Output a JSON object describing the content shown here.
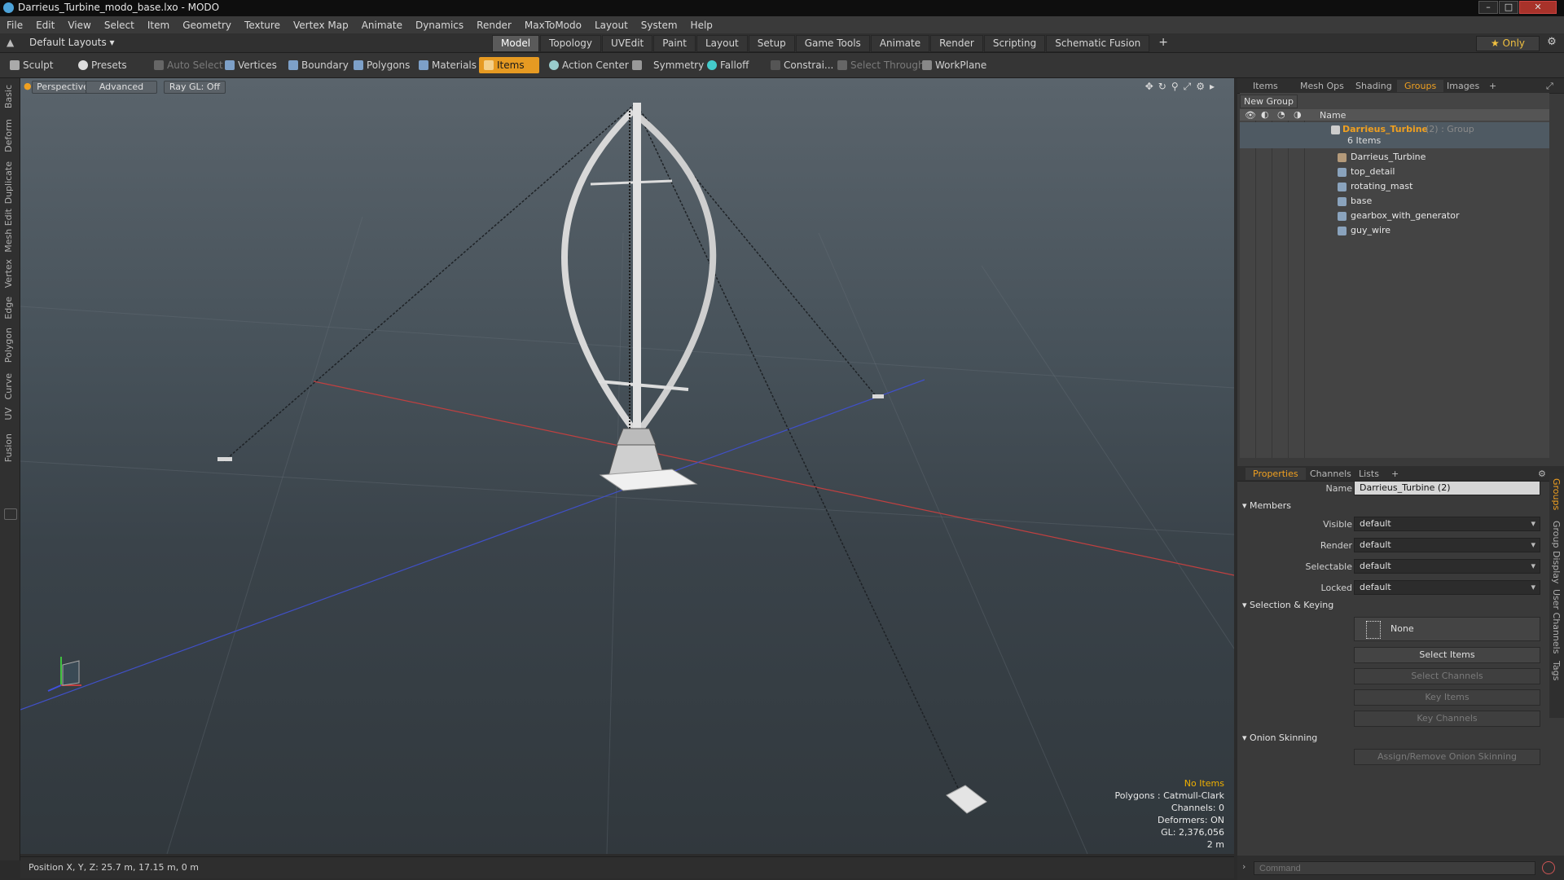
{
  "window": {
    "title": "Darrieus_Turbine_modo_base.lxo - MODO",
    "min": "–",
    "max": "□",
    "close": "✕"
  },
  "menu": [
    "File",
    "Edit",
    "View",
    "Select",
    "Item",
    "Geometry",
    "Texture",
    "Vertex Map",
    "Animate",
    "Dynamics",
    "Render",
    "MaxToModo",
    "Layout",
    "System",
    "Help"
  ],
  "layouts": {
    "select": "Default Layouts ▾",
    "tabs": [
      "Model",
      "Topology",
      "UVEdit",
      "Paint",
      "Layout",
      "Setup",
      "Game Tools",
      "Animate",
      "Render",
      "Scripting",
      "Schematic Fusion"
    ],
    "active": "Model",
    "add": "+",
    "only": "★ Only"
  },
  "toolbar": {
    "sculpt": "Sculpt",
    "presets": "Presets",
    "auto_select": "Auto Select",
    "vertices": "Vertices",
    "boundary": "Boundary",
    "polygons": "Polygons",
    "materials": "Materials",
    "items": "Items",
    "action_center": "Action Center",
    "symmetry": "Symmetry",
    "falloff": "Falloff",
    "constraints": "Constrai...",
    "select_through": "Select Through",
    "workplane": "WorkPlane"
  },
  "left_tabs": [
    "Basic",
    "Deform",
    "Duplicate",
    "Mesh Edit",
    "Vertex",
    "Edge",
    "Polygon",
    "Curve",
    "UV",
    "Fusion"
  ],
  "viewport": {
    "perspective": "Perspective",
    "advanced": "Advanced",
    "raygl": "Ray GL: Off",
    "icons": "✥↻⚲⤢⚙▸"
  },
  "viewport_info": {
    "no_items": "No Items",
    "polygons": "Polygons : Catmull-Clark",
    "channels": "Channels: 0",
    "deformers": "Deformers: ON",
    "gl": "GL: 2,376,056",
    "scale": "2 m"
  },
  "status": {
    "position": "Position X, Y, Z:  25.7 m, 17.15 m, 0 m"
  },
  "right_top_tabs": [
    "Items",
    "Mesh Ops",
    "Shading",
    "Groups",
    "Images"
  ],
  "right_top_active": "Groups",
  "groups": {
    "new_group": "New Group",
    "column_name": "Name",
    "root": {
      "name": "Darrieus_Turbine",
      "suffix": " (2) : Group",
      "count": "6 Items"
    },
    "children": [
      "Darrieus_Turbine",
      "top_detail",
      "rotating_mast",
      "base",
      "gearbox_with_generator",
      "guy_wire"
    ]
  },
  "prop_tabs": [
    "Properties",
    "Channels",
    "Lists"
  ],
  "prop_active": "Properties",
  "properties": {
    "name_label": "Name",
    "name_value": "Darrieus_Turbine (2)",
    "members": "Members",
    "visible_label": "Visible",
    "visible_value": "default",
    "render_label": "Render",
    "render_value": "default",
    "selectable_label": "Selectable",
    "selectable_value": "default",
    "locked_label": "Locked",
    "locked_value": "default",
    "selection_keying": "Selection & Keying",
    "none": "None",
    "select_items": "Select Items",
    "select_channels": "Select Channels",
    "key_items": "Key Items",
    "key_channels": "Key Channels",
    "onion": "Onion Skinning",
    "assign_onion": "Assign/Remove Onion Skinning"
  },
  "right_vtabs": [
    "Groups",
    "Group Display",
    "User Channels",
    "Tags"
  ],
  "command_placeholder": "Command"
}
